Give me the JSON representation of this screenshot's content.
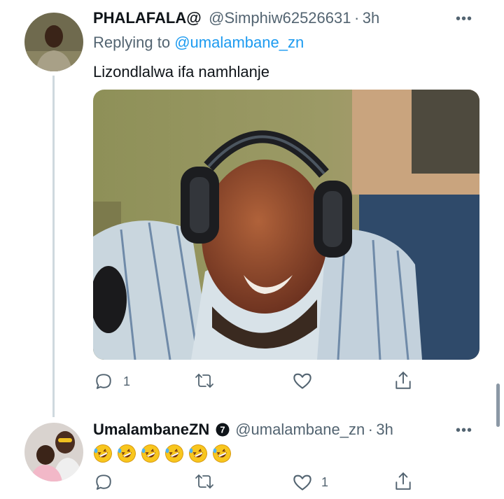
{
  "tweet1": {
    "display_name": "PHALAFALA@",
    "handle": "@Simphiw62526631",
    "separator": "·",
    "time": "3h",
    "reply_prefix": "Replying to ",
    "reply_to": "@umalambane_zn",
    "text": "Lizondlalwa ifa namhlanje",
    "more": "•••",
    "actions": {
      "reply_count": "1",
      "retweet_count": "",
      "like_count": ""
    }
  },
  "tweet2": {
    "display_name": "UmalambaneZN",
    "verified_icon": "verified-badge-icon",
    "handle": "@umalambane_zn",
    "separator": "·",
    "time": "3h",
    "emojis": [
      "rolling-on-floor-laughing",
      "rolling-on-floor-laughing",
      "rolling-on-floor-laughing",
      "rolling-on-floor-laughing",
      "rolling-on-floor-laughing",
      "rolling-on-floor-laughing"
    ],
    "more": "•••",
    "actions": {
      "reply_count": "",
      "retweet_count": "",
      "like_count": "1"
    }
  },
  "colors": {
    "handle": "#536471",
    "link": "#1d9bf0",
    "thread_line": "#cfd9de"
  }
}
